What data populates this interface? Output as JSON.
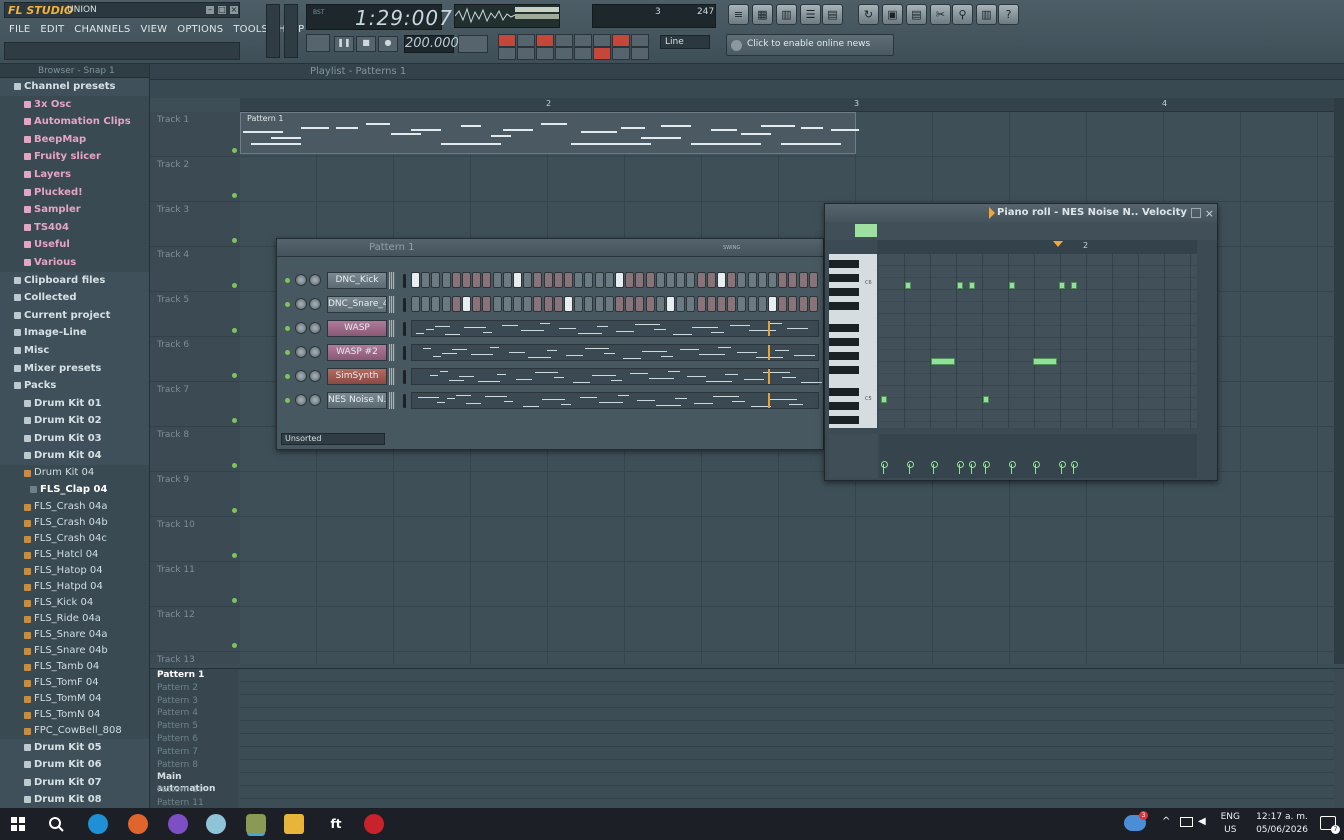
{
  "app": {
    "brand": "FL STUDIO",
    "project": "UNION"
  },
  "menu": [
    "FILE",
    "EDIT",
    "CHANNELS",
    "VIEW",
    "OPTIONS",
    "TOOLS",
    "HELP"
  ],
  "transport": {
    "time": "1:29:007",
    "time_label": "BST",
    "tempo": "200.000",
    "cpu": "3",
    "poly": "247",
    "snap": "Line"
  },
  "news": "Click to enable online news",
  "browser": {
    "title": "Browser - Snap 1",
    "items": [
      {
        "t": "Channel presets",
        "k": "root",
        "d": 1
      },
      {
        "t": "3x Osc",
        "k": "f",
        "d": 2
      },
      {
        "t": "Automation Clips",
        "k": "f",
        "d": 2
      },
      {
        "t": "BeepMap",
        "k": "f",
        "d": 2
      },
      {
        "t": "Fruity slicer",
        "k": "f",
        "d": 2
      },
      {
        "t": "Layers",
        "k": "f",
        "d": 2
      },
      {
        "t": "Plucked!",
        "k": "f",
        "d": 2
      },
      {
        "t": "Sampler",
        "k": "f",
        "d": 2
      },
      {
        "t": "TS404",
        "k": "f",
        "d": 2
      },
      {
        "t": "Useful",
        "k": "f",
        "d": 2
      },
      {
        "t": "Various",
        "k": "f",
        "d": 2
      },
      {
        "t": "Clipboard files",
        "k": "root",
        "d": 1
      },
      {
        "t": "Collected",
        "k": "root",
        "d": 1
      },
      {
        "t": "Current project",
        "k": "root",
        "d": 1
      },
      {
        "t": "Image-Line",
        "k": "root",
        "d": 1
      },
      {
        "t": "Misc",
        "k": "root",
        "d": 1
      },
      {
        "t": "Mixer presets",
        "k": "root",
        "d": 1
      },
      {
        "t": "Packs",
        "k": "root",
        "d": 1
      },
      {
        "t": "Drum Kit 01",
        "k": "root",
        "d": 2
      },
      {
        "t": "Drum Kit 02",
        "k": "root",
        "d": 2
      },
      {
        "t": "Drum Kit 03",
        "k": "root",
        "d": 2
      },
      {
        "t": "Drum Kit 04",
        "k": "root",
        "d": 2
      },
      {
        "t": "Drum Kit 04",
        "k": "fl",
        "d": 2
      },
      {
        "t": "FLS_Clap 04",
        "k": "sel",
        "d": 3
      },
      {
        "t": "FLS_Crash 04a",
        "k": "fl",
        "d": 2
      },
      {
        "t": "FLS_Crash 04b",
        "k": "fl",
        "d": 2
      },
      {
        "t": "FLS_Crash 04c",
        "k": "fl",
        "d": 2
      },
      {
        "t": "FLS_Hatcl 04",
        "k": "fl",
        "d": 2
      },
      {
        "t": "FLS_Hatop 04",
        "k": "fl",
        "d": 2
      },
      {
        "t": "FLS_Hatpd 04",
        "k": "fl",
        "d": 2
      },
      {
        "t": "FLS_Kick 04",
        "k": "fl",
        "d": 2
      },
      {
        "t": "FLS_Ride 04a",
        "k": "fl",
        "d": 2
      },
      {
        "t": "FLS_Snare 04a",
        "k": "fl",
        "d": 2
      },
      {
        "t": "FLS_Snare 04b",
        "k": "fl",
        "d": 2
      },
      {
        "t": "FLS_Tamb 04",
        "k": "fl",
        "d": 2
      },
      {
        "t": "FLS_TomF 04",
        "k": "fl",
        "d": 2
      },
      {
        "t": "FLS_TomM 04",
        "k": "fl",
        "d": 2
      },
      {
        "t": "FLS_TomN 04",
        "k": "fl",
        "d": 2
      },
      {
        "t": "FPC_CowBell_808",
        "k": "fl",
        "d": 2
      },
      {
        "t": "Drum Kit 05",
        "k": "root",
        "d": 2
      },
      {
        "t": "Drum Kit 06",
        "k": "root",
        "d": 2
      },
      {
        "t": "Drum Kit 07",
        "k": "root",
        "d": 2
      },
      {
        "t": "Drum Kit 08",
        "k": "root",
        "d": 2
      }
    ]
  },
  "playlist": {
    "title": "Playlist - Patterns 1",
    "bars": [
      "2",
      "3",
      "4"
    ],
    "tracks": [
      "Track 1",
      "Track 2",
      "Track 3",
      "Track 4",
      "Track 5",
      "Track 6",
      "Track 7",
      "Track 8",
      "Track 9",
      "Track 10",
      "Track 11",
      "Track 12",
      "Track 13"
    ],
    "clip": "Pattern 1"
  },
  "patterns": {
    "items": [
      "Pattern 1",
      "Pattern 2",
      "Pattern 3",
      "Pattern 4",
      "Pattern 5",
      "Pattern 6",
      "Pattern 7",
      "Pattern 8",
      "Main automation",
      "Pattern 10",
      "Pattern 11"
    ],
    "active": 0,
    "automation": 8
  },
  "rack": {
    "title": "Pattern 1",
    "swing": "SWING",
    "filter": "Unsorted",
    "channels": [
      {
        "name": "DNC_Kick",
        "color": "grey",
        "type": "steps",
        "on": [
          0,
          10,
          20,
          30
        ]
      },
      {
        "name": "DNC_Snare_4",
        "color": "grey",
        "type": "steps",
        "on": [
          5,
          15,
          25,
          35
        ]
      },
      {
        "name": "WASP",
        "color": "pink",
        "type": "roll"
      },
      {
        "name": "WASP #2",
        "color": "pink",
        "type": "roll"
      },
      {
        "name": "SimSynth",
        "color": "red",
        "type": "roll"
      },
      {
        "name": "NES Noise N...",
        "color": "grey",
        "type": "roll"
      }
    ]
  },
  "pianoroll": {
    "title": "Piano roll - NES Noise N..  Velocity",
    "bars": [
      "2"
    ],
    "key_labels": [
      "C6",
      "C5"
    ]
  },
  "taskbar": {
    "lang": "ENG",
    "region": "US",
    "time": "12:17 a. m.",
    "date": "05/06/2026",
    "badge": "3",
    "notif": "7"
  }
}
